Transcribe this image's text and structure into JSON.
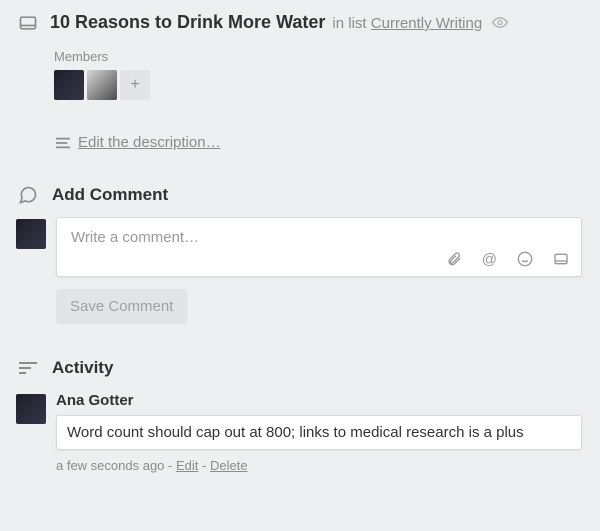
{
  "header": {
    "title": "10 Reasons to Drink More Water",
    "in_list_prefix": "in list",
    "list_name": "Currently Writing"
  },
  "members": {
    "label": "Members",
    "avatars": [
      "member-1",
      "member-2"
    ]
  },
  "description": {
    "edit_link": "Edit the description…"
  },
  "comment": {
    "heading": "Add Comment",
    "placeholder": "Write a comment…",
    "save_label": "Save Comment"
  },
  "activity": {
    "heading": "Activity",
    "entries": [
      {
        "author": "Ana Gotter",
        "text": "Word count should cap out at 800; links to medical research is a plus",
        "time": "a few seconds ago",
        "edit": "Edit",
        "delete": "Delete"
      }
    ]
  }
}
